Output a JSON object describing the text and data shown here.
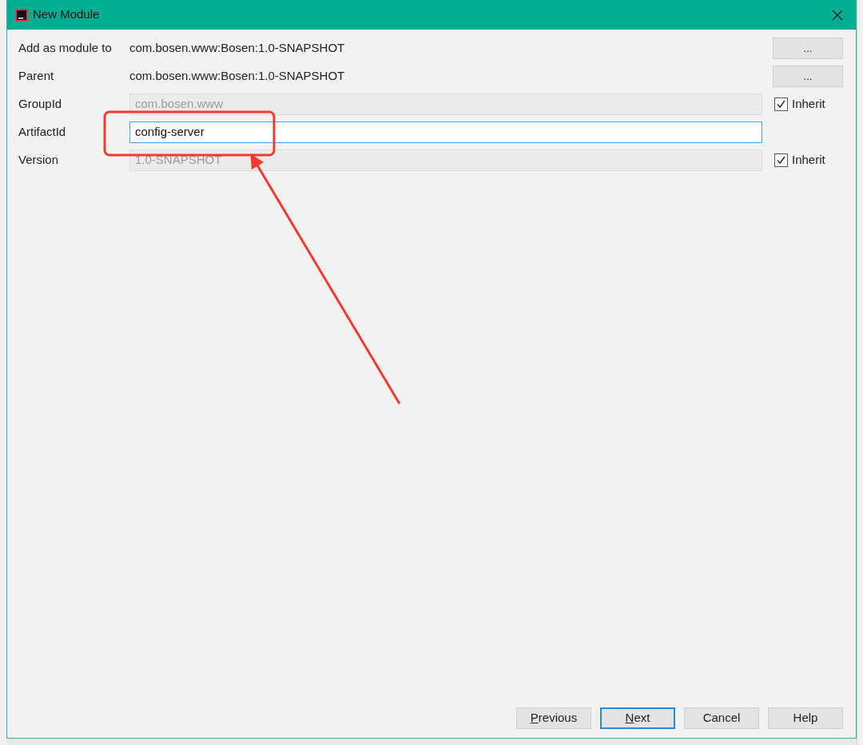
{
  "window": {
    "title": "New Module"
  },
  "rows": [
    {
      "kind": "text",
      "label": "Add as module to",
      "value": "com.bosen.www:Bosen:1.0-SNAPSHOT",
      "action": "..."
    },
    {
      "kind": "text",
      "label": "Parent",
      "value": "com.bosen.www:Bosen:1.0-SNAPSHOT",
      "action": "..."
    },
    {
      "kind": "field",
      "label": "GroupId",
      "value": "com.bosen.www",
      "disabled": true,
      "focused": false,
      "inherit": {
        "label": "Inherit",
        "checked": true
      }
    },
    {
      "kind": "field",
      "label": "ArtifactId",
      "value": "config-server",
      "disabled": false,
      "focused": true
    },
    {
      "kind": "field",
      "label": "Version",
      "value": "1.0-SNAPSHOT",
      "disabled": true,
      "focused": false,
      "inherit": {
        "label": "Inherit",
        "checked": true
      }
    }
  ],
  "buttons": [
    {
      "label": "Previous",
      "mnemonic": true,
      "default": false
    },
    {
      "label": "Next",
      "mnemonic": true,
      "default": true
    },
    {
      "label": "Cancel",
      "mnemonic": false,
      "default": false
    },
    {
      "label": "Help",
      "mnemonic": false,
      "default": false
    }
  ]
}
